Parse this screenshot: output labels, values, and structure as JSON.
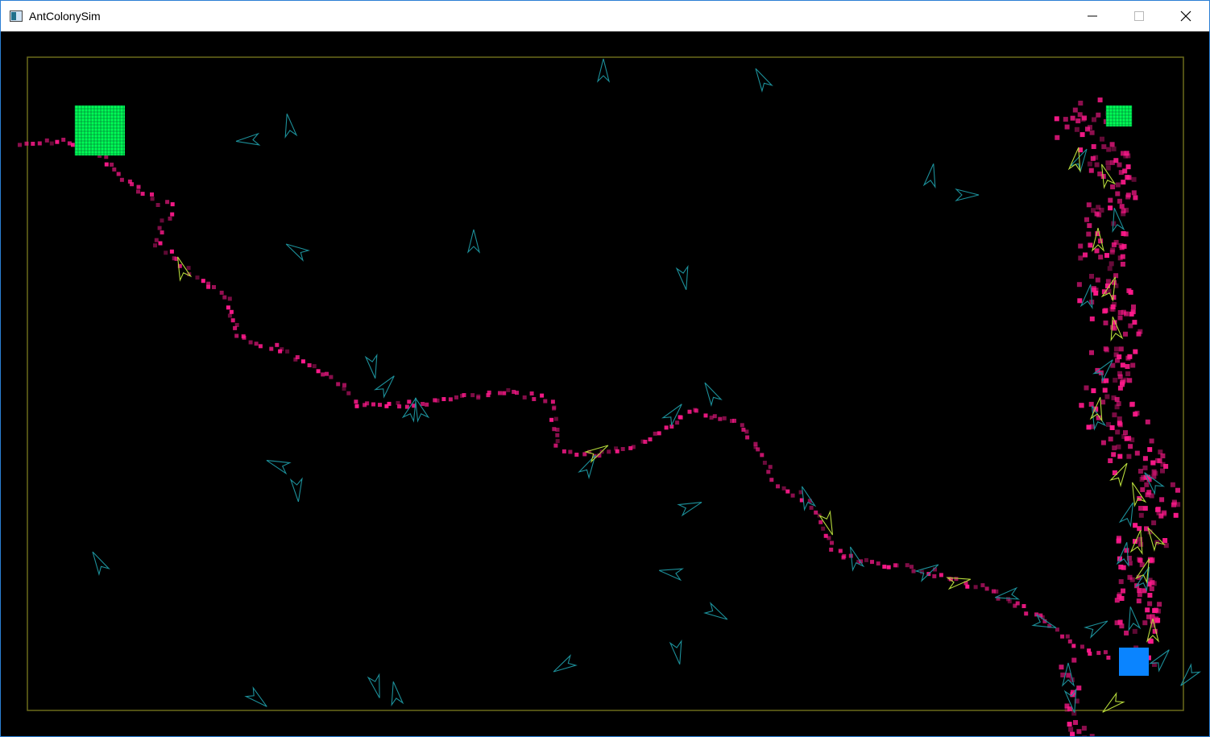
{
  "window": {
    "title": "AntColonySim",
    "icon": "app-window-icon",
    "border_color": "#2b7fd4"
  },
  "controls": {
    "minimize_icon": "minimize-icon",
    "maximize_icon": "maximize-icon",
    "close_icon": "close-icon"
  },
  "simulation": {
    "background": "#000000",
    "border_color": "#6b6b1a",
    "food_color": "#00ff55",
    "nest_color": "#0a84ff",
    "pheromone_color": "#ff1a8c",
    "ant_searching_color": "#1c8f99",
    "ant_returning_color": "#b5d93a",
    "food_sources": 2,
    "nests": 1
  }
}
